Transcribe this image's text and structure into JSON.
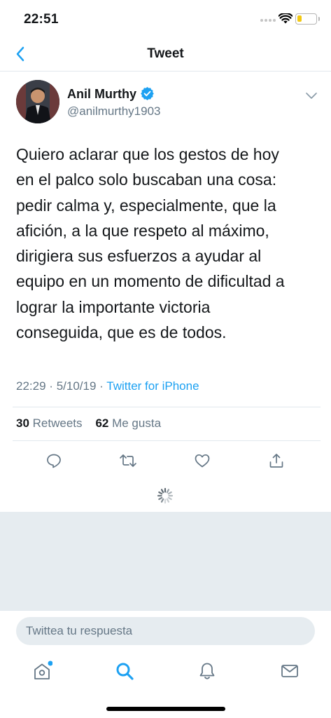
{
  "status_bar": {
    "time": "22:51",
    "battery_level": 0.25,
    "battery_color": "#f2c811"
  },
  "nav": {
    "title": "Tweet",
    "back_icon": "chevron-left-icon"
  },
  "tweet": {
    "author_name": "Anil Murthy",
    "author_handle": "@anilmurthy1903",
    "verified": true,
    "text_lines": [
      "Quiero aclarar que los gestos de hoy",
      "en el palco solo buscaban una cosa:",
      "pedir calma y, especialmente, que la",
      "afición, a la que respeto al máximo,",
      "dirigiera sus esfuerzos a ayudar al",
      "equipo en un momento de dificultad a",
      "lograr la importante victoria",
      "conseguida, que es de todos."
    ],
    "time": "22:29",
    "meta_separator": "·",
    "date": "5/10/19",
    "source": "Twitter for iPhone",
    "retweets_count": "30",
    "retweets_label": "Retweets",
    "likes_count": "62",
    "likes_label": "Me gusta"
  },
  "actions": [
    "reply-icon",
    "retweet-icon",
    "like-icon",
    "share-icon"
  ],
  "reply": {
    "placeholder": "Twittea tu respuesta"
  },
  "tabs": [
    {
      "icon": "home-icon",
      "active": false,
      "has_badge": true
    },
    {
      "icon": "search-icon",
      "active": true
    },
    {
      "icon": "notifications-icon",
      "active": false
    },
    {
      "icon": "messages-icon",
      "active": false
    }
  ],
  "colors": {
    "accent": "#1da1f2",
    "text_primary": "#14171a",
    "text_secondary": "#657786",
    "divider": "#e1e8ed",
    "gray_background": "#e6ecf0"
  }
}
